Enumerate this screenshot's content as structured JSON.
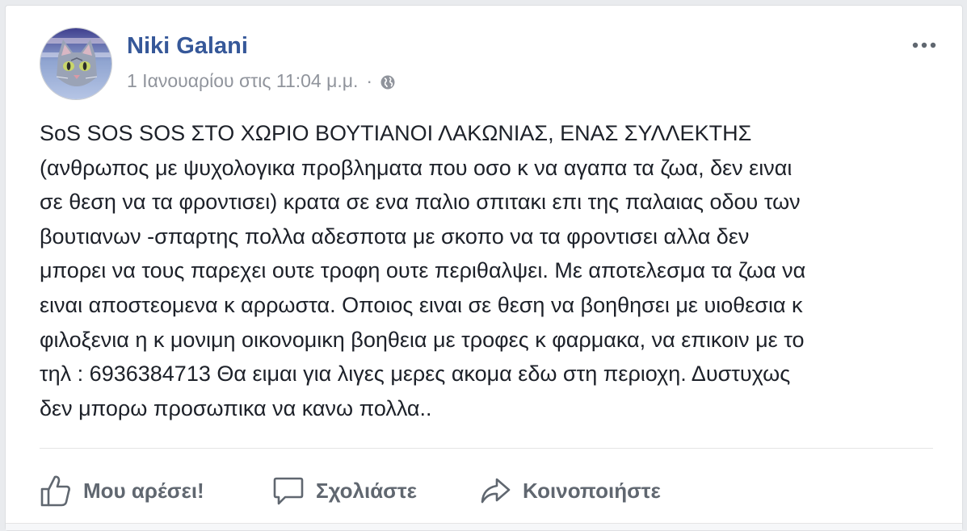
{
  "post": {
    "author": "Niki Galani",
    "timestamp": "1 Ιανουαρίου στις 11:04 μ.μ.",
    "separator": "·",
    "privacy_icon": "globe-icon",
    "more_icon": "more-options-icon",
    "text_lines": [
      "SoS SOS SOS ΣΤΟ ΧΩΡΙΟ ΒΟΥΤΙΑΝΟΙ ΛΑΚΩΝΙΑΣ, ΕΝΑΣ ΣΥΛΛΕΚΤΗΣ",
      "(ανθρωπος με ψυχολογικα προβληματα που οσο κ να αγαπα τα ζωα, δεν ειναι",
      "σε θεση να τα φροντισει) κρατα σε ενα παλιο σπιτακι επι της παλαιας οδου των",
      "βουτιανων -σπαρτης πολλα αδεσποτα με σκοπο να τα φροντισει αλλα δεν",
      "μπορει να τους παρεχει ουτε τροφη ουτε περιθαλψει. Με αποτελεσμα τα ζωα να",
      "ειναι αποστεομενα κ αρρωστα. Οποιος ειναι σε θεση να βοηθησει με υιοθεσια κ",
      "φιλοξενια η κ μονιμη οικονομικη βοηθεια με τροφες κ φαρμακα, να επικοιν με το",
      "τηλ : 6936384713 Θα ειμαι για λιγες μερες ακομα εδω στη περιοχη. Δυστυχως",
      "δεν μπορω προσωπικα να κανω πολλα.."
    ]
  },
  "actions": {
    "like_label": "Μου αρέσει!",
    "comment_label": "Σχολιάστε",
    "share_label": "Κοινοποιήστε",
    "like_icon": "thumbs-up-icon",
    "comment_icon": "comment-bubble-icon",
    "share_icon": "share-arrow-icon"
  },
  "colors": {
    "author_link": "#365899",
    "meta_text": "#90949c",
    "body_text": "#1d2129",
    "action_text": "#606770",
    "page_background": "#e9ebee"
  }
}
